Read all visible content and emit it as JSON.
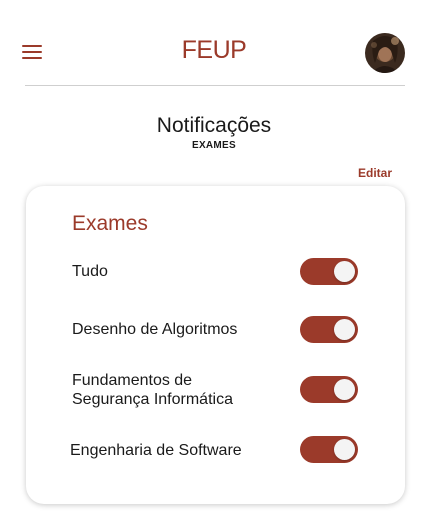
{
  "header": {
    "logo": "FEUP"
  },
  "page": {
    "title": "Notificações",
    "subtitle": "EXAMES",
    "edit_label": "Editar"
  },
  "card": {
    "title": "Exames",
    "items": [
      {
        "label": "Tudo",
        "enabled": true
      },
      {
        "label": "Desenho de Algoritmos",
        "enabled": true
      },
      {
        "label": "Fundamentos de Segurança Informática",
        "enabled": true
      },
      {
        "label": "Engenharia de Software",
        "enabled": true
      }
    ]
  },
  "colors": {
    "accent": "#9b3a2a",
    "toggle_knob": "#f4f4f4"
  }
}
